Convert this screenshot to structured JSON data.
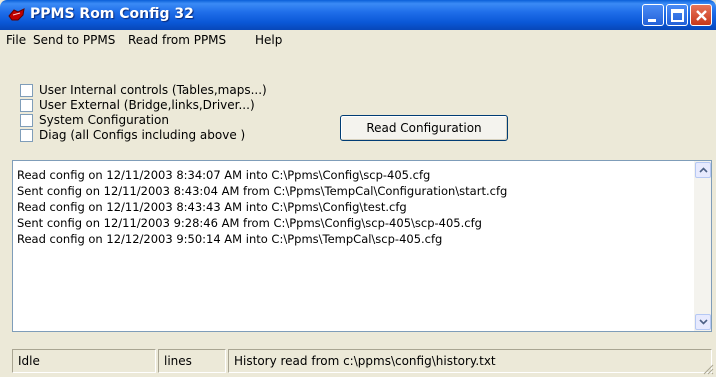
{
  "window": {
    "title": "PPMS Rom Config 32",
    "minimize_icon": "minimize-icon",
    "maximize_icon": "maximize-icon",
    "close_icon": "close-icon"
  },
  "menu": {
    "items": [
      {
        "label": "File"
      },
      {
        "label": "Send to PPMS"
      },
      {
        "label": "Read from PPMS"
      },
      {
        "label": "Help"
      }
    ]
  },
  "options": {
    "checkboxes": [
      {
        "label": "User Internal controls (Tables,maps...)",
        "checked": false
      },
      {
        "label": "User External  (Bridge,links,Driver...)",
        "checked": false
      },
      {
        "label": "System Configuration",
        "checked": false
      },
      {
        "label": "Diag (all Configs including above )",
        "checked": false
      }
    ],
    "read_button_label": "Read Configuration"
  },
  "log": {
    "lines": [
      "Read config on 12/11/2003 8:34:07 AM into C:\\Ppms\\Config\\scp-405.cfg",
      "Sent config on 12/11/2003 8:43:04 AM from C:\\Ppms\\TempCal\\Configuration\\start.cfg",
      "Read config on 12/11/2003 8:43:43 AM into C:\\Ppms\\Config\\test.cfg",
      "Sent config on 12/11/2003 9:28:46 AM from C:\\Ppms\\Config\\scp-405\\scp-405.cfg",
      "Read config on 12/12/2003 9:50:14 AM into C:\\Ppms\\TempCal\\scp-405.cfg"
    ]
  },
  "status": {
    "state": "Idle",
    "lines_label": "lines",
    "message": "History read from c:\\ppms\\config\\history.txt"
  },
  "colors": {
    "titlebar": "#0A57D6",
    "window_bg": "#ECE9D8",
    "close_button": "#C7381A"
  }
}
